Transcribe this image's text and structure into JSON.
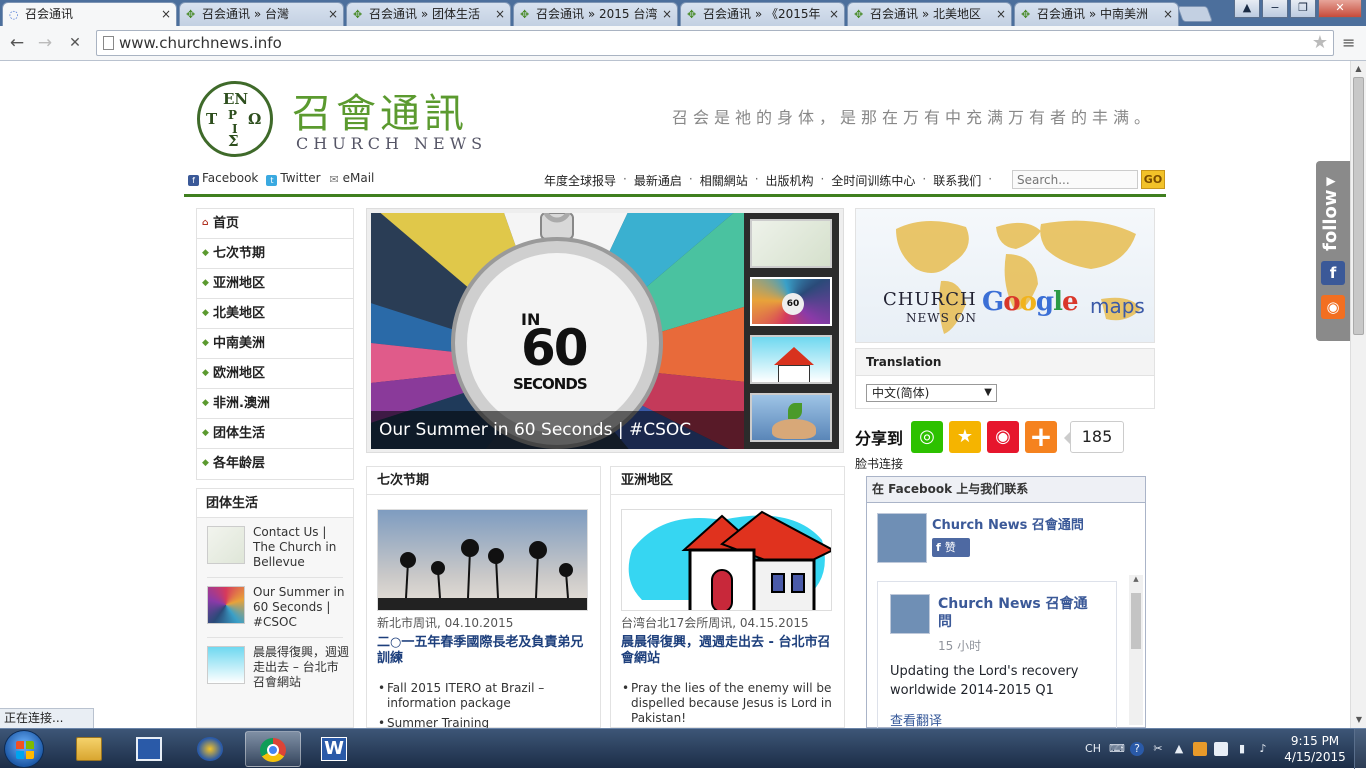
{
  "browser": {
    "tabs": [
      {
        "title": "召会通讯",
        "active": true,
        "loading": true
      },
      {
        "title": "召会通讯 » 台灣",
        "active": false
      },
      {
        "title": "召会通讯 » 团体生活",
        "active": false
      },
      {
        "title": "召会通讯 » 2015 台湾",
        "active": false
      },
      {
        "title": "召会通讯 » 《2015年",
        "active": false
      },
      {
        "title": "召会通讯 » 北美地区",
        "active": false
      },
      {
        "title": "召会通讯 » 中南美洲",
        "active": false
      }
    ],
    "tab_close_glyph": "×",
    "window_buttons": {
      "minimize": "−",
      "restore": "❐",
      "close": "✕"
    },
    "back_glyph": "←",
    "forward_glyph": "→",
    "stop_glyph": "✕",
    "url": "www.churchnews.info",
    "bookmark_glyph": "★",
    "menu_glyph": "≡",
    "status_text": "正在连接..."
  },
  "site": {
    "logo": {
      "seal_letters": [
        "EN",
        "T",
        "Ω",
        "P",
        "I",
        "Σ"
      ],
      "title_cn": "召會通訊",
      "title_en": "CHURCH NEWS"
    },
    "tagline": "召会是祂的身体，是那在万有中充满万有者的丰满。",
    "social": [
      {
        "icon": "facebook-icon",
        "glyph": "f",
        "label": "Facebook",
        "color": "#3b5998"
      },
      {
        "icon": "twitter-icon",
        "glyph": "t",
        "label": "Twitter",
        "color": "#3aa9e0"
      },
      {
        "icon": "email-icon",
        "glyph": "✉",
        "label": "eMail",
        "color": "#888888"
      }
    ],
    "topnav": [
      "年度全球报导",
      "最新通启",
      "相關網站",
      "出版机构",
      "全时间训练中心",
      "联系我们"
    ],
    "topnav_sep": "·",
    "search": {
      "placeholder": "Search...",
      "button": "GO"
    },
    "leftnav": [
      "首页",
      "七次节期",
      "亚洲地区",
      "北美地区",
      "中南美洲",
      "欧洲地区",
      "非洲.澳洲",
      "团体生活",
      "各年龄层"
    ],
    "leftnav_bullet": "◆",
    "home_bullet": "⌂",
    "group_life": {
      "title": "团体生活",
      "items": [
        {
          "text": "Contact Us | The Church in Bellevue"
        },
        {
          "text": "Our Summer in 60 Seconds | #CSOC"
        },
        {
          "text": "晨晨得復興，週週走出去 – 台北市召會網站"
        }
      ]
    },
    "slider": {
      "caption": "Our Summer in 60 Seconds | #CSOC",
      "image_text_top": "IN",
      "image_text_mid": "60",
      "image_text_bot": "SECONDS",
      "thumb_text": "60"
    },
    "posts": [
      {
        "section": "七次节期",
        "meta": "新北市周讯, 04.10.2015",
        "title": "二○一五年春季國際長老及負責弟兄訓練",
        "bullets": [
          "Fall 2015 ITERO at Brazil – information package",
          "Summer Training"
        ]
      },
      {
        "section": "亚洲地区",
        "meta": "台湾台北17会所周讯, 04.15.2015",
        "title": "晨晨得復興，週週走出去 - 台北市召會網站",
        "bullets": [
          "Pray the lies of the enemy will be dispelled because Jesus is Lord in Pakistan!"
        ]
      }
    ],
    "map": {
      "line1": "CHURCH",
      "line2": "NEWS ON",
      "google": [
        "G",
        "o",
        "o",
        "g",
        "l",
        "e"
      ],
      "google_colors": [
        "#3b6fd6",
        "#d9372a",
        "#f1b31c",
        "#3b6fd6",
        "#2b9a45",
        "#d9372a"
      ],
      "maps": "maps"
    },
    "translation": {
      "title": "Translation",
      "selected": "中文(简体)",
      "caret": "▼"
    },
    "share": {
      "label": "分享到",
      "icons": [
        {
          "name": "wechat-icon",
          "glyph": "◎",
          "color": "#2dc100"
        },
        {
          "name": "qzone-icon",
          "glyph": "★",
          "color": "#f5b400"
        },
        {
          "name": "weibo-icon",
          "glyph": "◉",
          "color": "#e6162d"
        },
        {
          "name": "more-share-icon",
          "glyph": "+",
          "color": "#f5821f"
        }
      ],
      "count": "185",
      "facebook_link_label": "脸书连接"
    },
    "facebook": {
      "header": "在 Facebook 上与我们联系",
      "page_name": "Church News 召會通問",
      "like_glyph": "f",
      "like_label": "赞",
      "post_page_name": "Church News 召會通問",
      "post_time": "15 小时",
      "post_text": "Updating the Lord's recovery worldwide 2014-2015 Q1",
      "see_translation": "查看翻译",
      "scroll_up": "▲"
    },
    "follow": {
      "label": "follow",
      "arrow": "◀",
      "facebook_glyph": "f",
      "rss_glyph": "◉",
      "facebook_color": "#3b5998",
      "rss_color": "#f26f21"
    }
  },
  "scrollbar": {
    "up": "▲",
    "down": "▼"
  },
  "taskbar": {
    "apps": [
      "file-explorer",
      "windows-explorer-tiles",
      "media-player",
      "chrome",
      "wps-writer"
    ],
    "tray": {
      "lang": "CH",
      "keyboard_glyph": "⌨",
      "help_glyph": "?",
      "tools_glyph": "✂",
      "network_glyph": "▮",
      "volume_glyph": "♪",
      "flag_glyph": "▲"
    },
    "time": "9:15 PM",
    "date": "4/15/2015"
  }
}
